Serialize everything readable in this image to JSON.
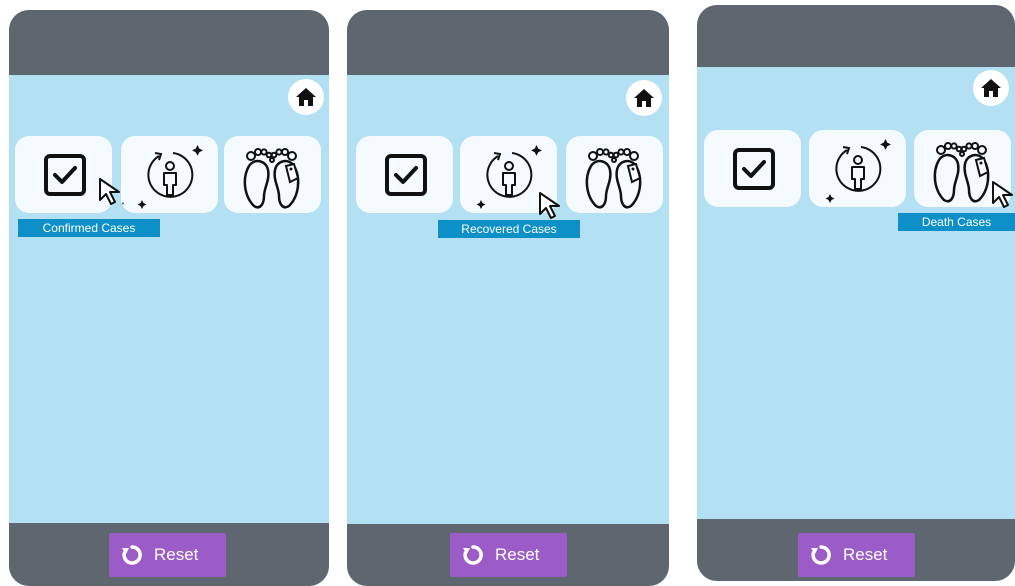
{
  "panels": [
    {
      "tooltip": "Confirmed Cases",
      "active_tile": "confirmed-cases"
    },
    {
      "tooltip": "Recovered Cases",
      "active_tile": "recovered-cases"
    },
    {
      "tooltip": "Death Cases",
      "active_tile": "death-cases"
    }
  ],
  "reset_label": "Reset",
  "icons": {
    "home": "home-icon",
    "confirmed": "checkbox-checked-icon",
    "recovered": "recovered-person-icon",
    "death": "toe-tag-feet-icon",
    "reset": "refresh-icon",
    "cursor": "mouse-cursor-icon"
  },
  "colors": {
    "header": "#5e6770",
    "background": "#b3e1f3",
    "tile": "#f4fafd",
    "tooltip": "#0d90c8",
    "reset": "#9c5cc7"
  }
}
